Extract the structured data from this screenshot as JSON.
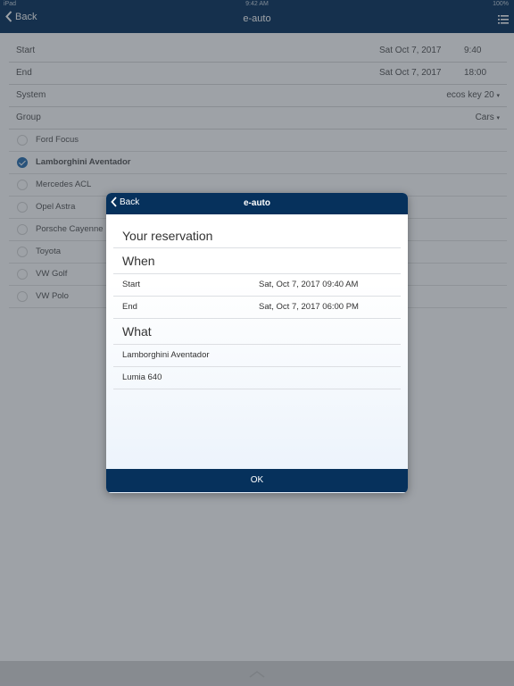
{
  "statusbar": {
    "carrier": "iPad",
    "time": "9:42 AM",
    "battery": "100%"
  },
  "navbar": {
    "back_label": "Back",
    "title": "e-auto"
  },
  "form": {
    "start": {
      "label": "Start",
      "date": "Sat Oct 7, 2017",
      "time": "9:40"
    },
    "end": {
      "label": "End",
      "date": "Sat Oct 7, 2017",
      "time": "18:00"
    },
    "system": {
      "label": "System",
      "value": "ecos key 20"
    },
    "group": {
      "label": "Group",
      "value": "Cars"
    }
  },
  "cars": [
    {
      "name": "Ford Focus",
      "selected": false
    },
    {
      "name": "Lamborghini Aventador",
      "selected": true
    },
    {
      "name": "Mercedes ACL",
      "selected": false
    },
    {
      "name": "Opel Astra",
      "selected": false
    },
    {
      "name": "Porsche Cayenne",
      "selected": false
    },
    {
      "name": "Toyota",
      "selected": false
    },
    {
      "name": "VW Golf",
      "selected": false
    },
    {
      "name": "VW Polo",
      "selected": false
    }
  ],
  "dialog": {
    "back_label": "Back",
    "title": "e-auto",
    "heading": "Your reservation",
    "when_heading": "When",
    "start_label": "Start",
    "start_value": "Sat, Oct 7, 2017 09:40 AM",
    "end_label": "End",
    "end_value": "Sat, Oct 7, 2017 06:00 PM",
    "what_heading": "What",
    "items": [
      "Lamborghini Aventador",
      "Lumia 640"
    ],
    "ok_label": "OK"
  },
  "colors": {
    "navbar": "#06315c",
    "accent": "#2a6fb0"
  }
}
